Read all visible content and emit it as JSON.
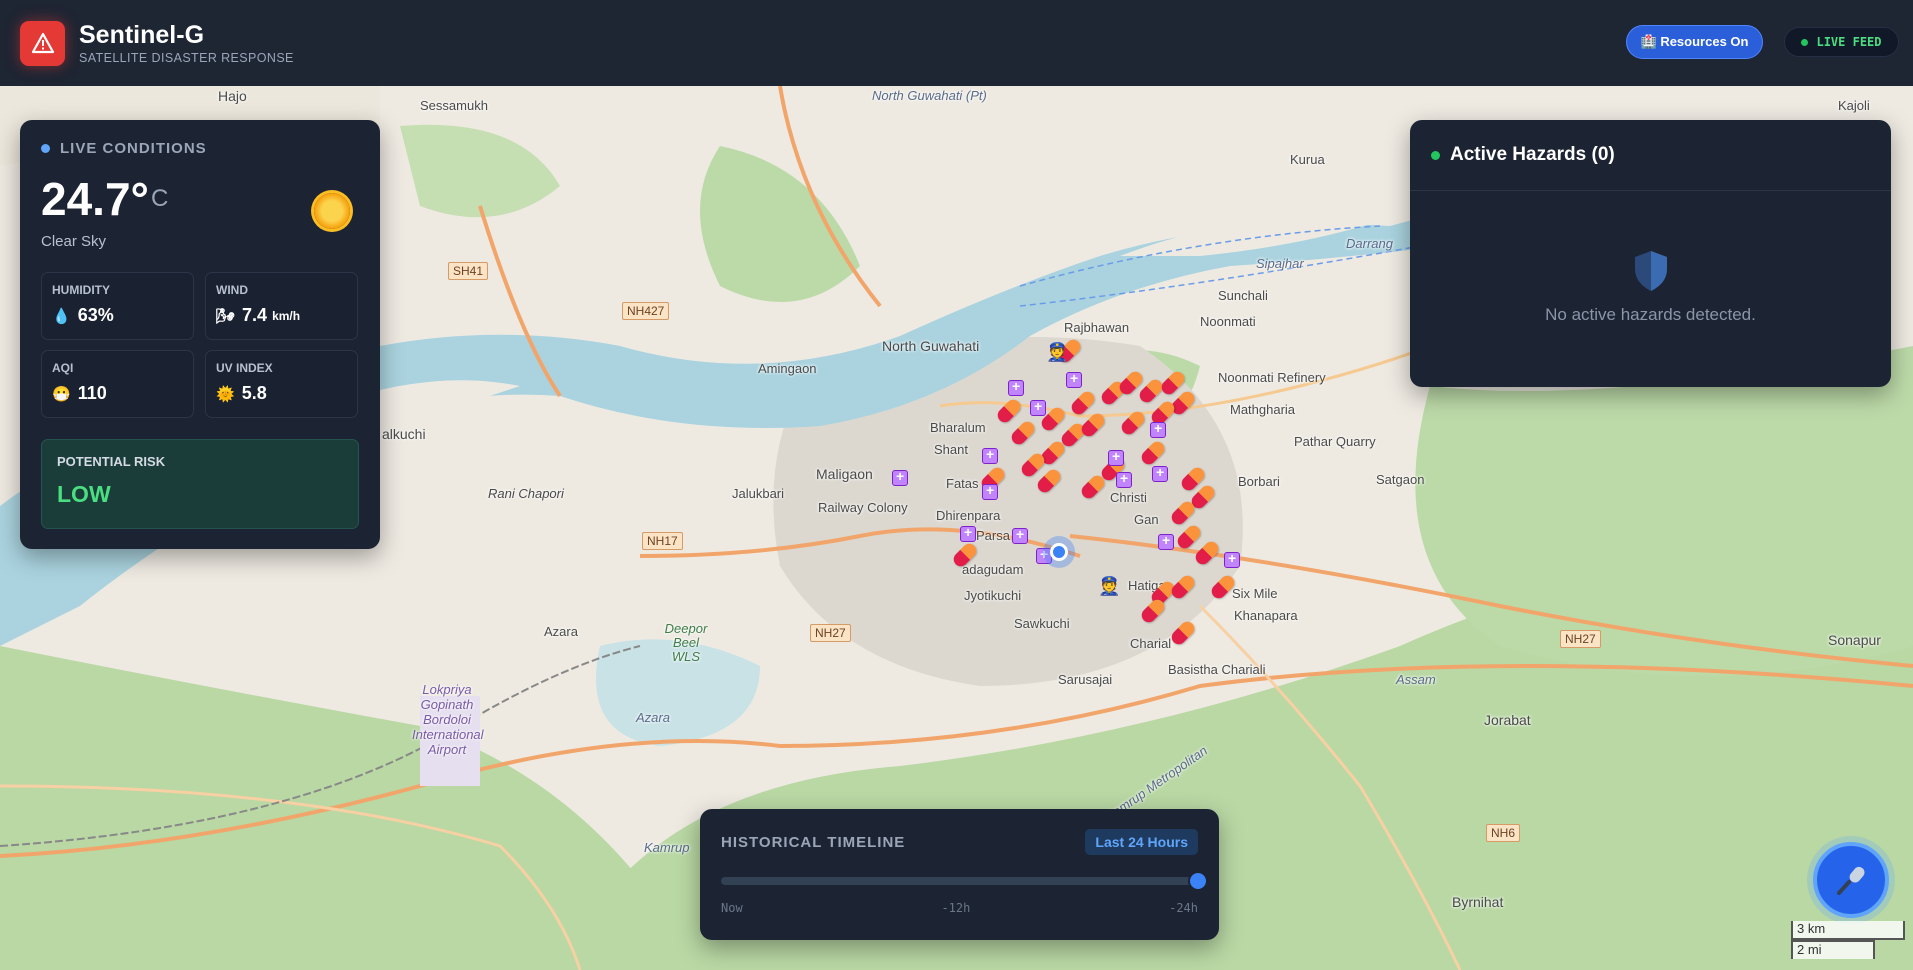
{
  "app": {
    "title": "Sentinel-G",
    "subtitle": "SATELLITE DISASTER RESPONSE",
    "resources_button": "🏥 Resources On",
    "live_feed": "LIVE FEED"
  },
  "conditions": {
    "heading": "LIVE CONDITIONS",
    "temperature": "24.7°",
    "temperature_unit": "C",
    "condition": "Clear Sky",
    "humidity_label": "HUMIDITY",
    "humidity_value": "63%",
    "wind_label": "WIND",
    "wind_value": "7.4",
    "wind_unit": "km/h",
    "aqi_label": "AQI",
    "aqi_value": "110",
    "uv_label": "UV INDEX",
    "uv_value": "5.8",
    "risk_label": "POTENTIAL RISK",
    "risk_value": "LOW"
  },
  "hazards": {
    "title": "Active Hazards (0)",
    "empty_message": "No active hazards detected."
  },
  "timeline": {
    "title": "HISTORICAL TIMELINE",
    "range_badge": "Last 24 Hours",
    "tick_now": "Now",
    "tick_mid": "-12h",
    "tick_end": "-24h",
    "position": 1.0
  },
  "map": {
    "places": {
      "hajo": "Hajo",
      "sessamukh": "Sessamukh",
      "north_guwahati_pt": "North Guwahati (Pt)",
      "kurua": "Kurua",
      "kajoli": "Kajoli",
      "sh41": "SH41",
      "nh427": "NH427",
      "north_guwahati": "North Guwahati",
      "amingaon": "Amingaon",
      "rajbhawan": "Rajbhawan",
      "sunchali": "Sunchali",
      "noonmati": "Noonmati",
      "noonmati_refinery": "Noonmati Refinery",
      "mathgharia": "Mathgharia",
      "pathar_quarry": "Pathar Quarry",
      "satgaon": "Satgaon",
      "borbari": "Borbari",
      "alkuchi": "alkuchi",
      "bharalum": "Bharalum",
      "shant": "Shant",
      "maligaon": "Maligaon",
      "jalukbari": "Jalukbari",
      "railway_colony": "Railway Colony",
      "fatas": "Fatas",
      "dhirenpara": "Dhirenpara",
      "parsa": "Parsa",
      "adagudam": "adagudam",
      "jyotikuchi": "Jyotikuchi",
      "hatigao": "Hatigao",
      "six_mile": "Six Mile",
      "khanapara": "Khanapara",
      "rani_chapori": "Rani Chapori",
      "nh17": "NH17",
      "azara": "Azara",
      "deepor_beel": "Deepor Beel WLS",
      "nh27": "NH27",
      "sawkuchi": "Sawkuchi",
      "charial": "Charial",
      "basistha_chariali": "Basistha Chariali",
      "sarusajai": "Sarusajai",
      "nh27_east": "NH27",
      "sonapur": "Sonapur",
      "jorabat": "Jorabat",
      "airport": "Lokpriya Gopinath Bordoloi International Airport",
      "azara_small": "Azara",
      "nh6": "NH6",
      "byrnihat": "Byrnihat",
      "sipajhar": "Sipajhar",
      "darrang": "Darrang",
      "kamrup": "Kamrup",
      "kamrup_metropolitan": "Kamrup Metropolitan",
      "assam": "Assam",
      "christi": "Christi",
      "gan": "Gan"
    },
    "scale_km": "3 km",
    "scale_mi": "2 mi"
  },
  "colors": {
    "accent": "#2b5fd9",
    "danger": "#e53935",
    "safe": "#4ade80",
    "panel": "#1c2333"
  }
}
